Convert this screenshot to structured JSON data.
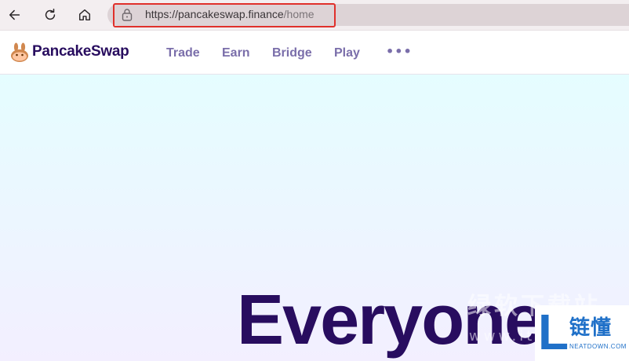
{
  "browser": {
    "url_host": "https://pancakeswap.finance",
    "url_path": "/home"
  },
  "header": {
    "brand": "PancakeSwap",
    "menu": [
      {
        "label": "Trade"
      },
      {
        "label": "Earn"
      },
      {
        "label": "Bridge"
      },
      {
        "label": "Play"
      }
    ],
    "more": "•••"
  },
  "hero": {
    "headline": "Everyone"
  },
  "watermark": {
    "text": "绿软下载站",
    "url": "www.it",
    "badge_letter": "L",
    "badge_cn": "链懂",
    "badge_en": "NEATDOWN.COM"
  },
  "colors": {
    "brand_text": "#280d5f",
    "menu_text": "#7a6eaa",
    "highlight_box": "#e0302b",
    "badge_blue": "#1f70c8"
  },
  "icons": [
    "back-arrow-icon",
    "refresh-icon",
    "home-icon",
    "lock-icon",
    "pancake-bunny-logo-icon",
    "more-dots-icon"
  ]
}
